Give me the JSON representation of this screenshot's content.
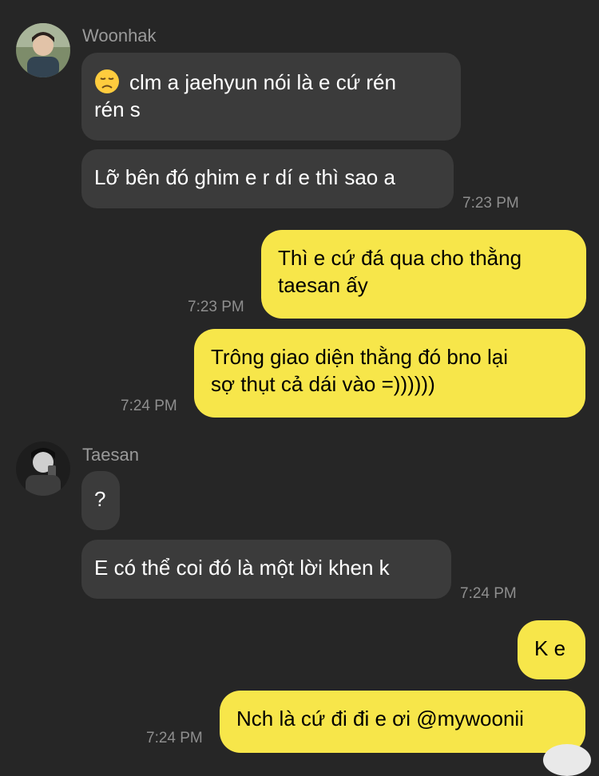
{
  "chat": {
    "groups": [
      {
        "sender": "Woonhak",
        "messages": [
          {
            "emoji": "disappointed-face",
            "line1": "clm a jaehyun nói là e cứ rén",
            "line2": "rén s"
          },
          {
            "text": "Lỡ bên đó ghim e r dí e thì sao a",
            "time": "7:23 PM"
          }
        ]
      },
      {
        "sender": "me",
        "messages": [
          {
            "line1": "Thì e cứ đá qua cho thằng",
            "line2": "taesan ấy",
            "time": "7:23 PM"
          },
          {
            "line1": "Trông giao diện thằng đó bno lại",
            "line2": "sợ thụt cả dái vào =))))))",
            "time": "7:24 PM"
          }
        ]
      },
      {
        "sender": "Taesan",
        "messages": [
          {
            "text": "?"
          },
          {
            "text": "E có thể coi đó là một lời khen k",
            "time": "7:24 PM"
          }
        ]
      },
      {
        "sender": "me",
        "messages": [
          {
            "text": "K e"
          },
          {
            "text": "Nch là cứ đi đi e ơi @mywoonii",
            "time": "7:24 PM"
          }
        ]
      }
    ]
  },
  "colors": {
    "background": "#262626",
    "incoming_bubble": "#3b3b3b",
    "outgoing_bubble": "#f7e64a"
  }
}
